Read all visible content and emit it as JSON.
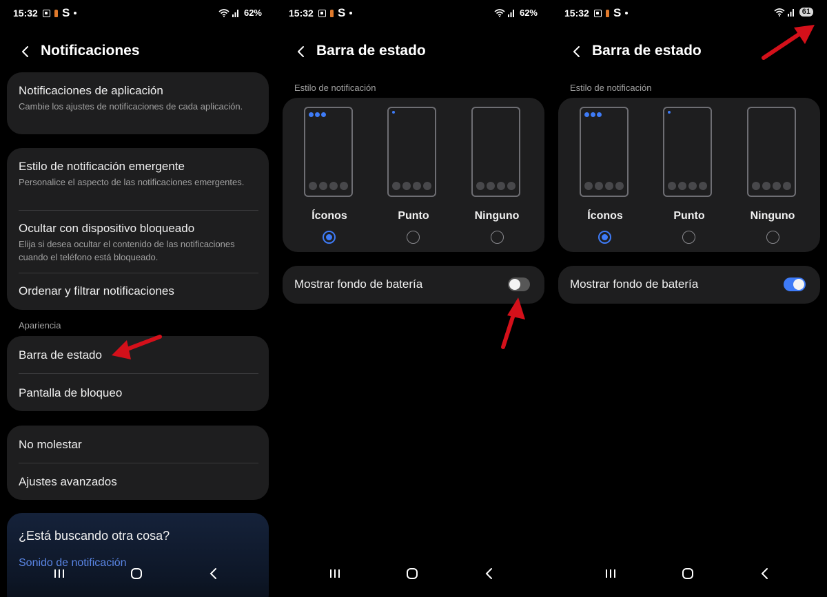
{
  "status": {
    "time": "15:32",
    "s_glyph": "S",
    "battery_p1": "62%",
    "battery_p2": "62%",
    "battery_p3": "61"
  },
  "panel1": {
    "title": "Notificaciones",
    "app_notifications": {
      "title": "Notificaciones de aplicación",
      "subtitle": "Cambie los ajustes de notificaciones de cada aplicación."
    },
    "popup_style": {
      "title": "Estilo de notificación emergente",
      "subtitle": "Personalice el aspecto de las notificaciones emergentes."
    },
    "hide_locked": {
      "title": "Ocultar con dispositivo bloqueado",
      "subtitle": "Elija si desea ocultar el contenido de las notificaciones cuando el teléfono está bloqueado."
    },
    "sort_filter": "Ordenar y filtrar notificaciones",
    "appearance_label": "Apariencia",
    "status_bar": "Barra de estado",
    "lock_screen": "Pantalla de bloqueo",
    "dnd": "No molestar",
    "advanced": "Ajustes avanzados",
    "search_title": "¿Está buscando otra cosa?",
    "search_link": "Sonido de notificación"
  },
  "panel2": {
    "title": "Barra de estado",
    "section_label": "Estilo de notificación",
    "options": [
      "Íconos",
      "Punto",
      "Ninguno"
    ],
    "selected_option": "Íconos",
    "battery_toggle_label": "Mostrar fondo de batería",
    "battery_toggle_on": false
  },
  "panel3": {
    "title": "Barra de estado",
    "section_label": "Estilo de notificación",
    "options": [
      "Íconos",
      "Punto",
      "Ninguno"
    ],
    "selected_option": "Íconos",
    "battery_toggle_label": "Mostrar fondo de batería",
    "battery_toggle_on": true
  },
  "colors": {
    "background": "#000000",
    "card": "#1e1e1f",
    "accent": "#3e7bf7",
    "annotation_arrow": "#d4101a"
  }
}
